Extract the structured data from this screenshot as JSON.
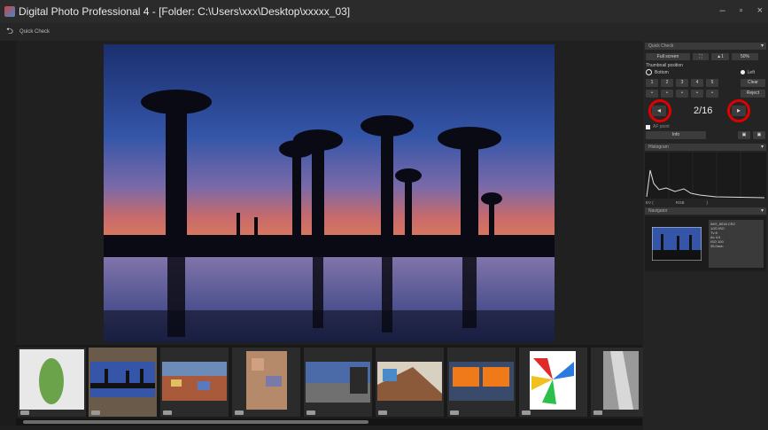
{
  "window": {
    "title": "Digital Photo Professional 4 - [Folder: C:\\Users\\xxx\\Desktop\\xxxxx_03]",
    "minimize_glyph": "–",
    "maximize_glyph": "▫",
    "close_glyph": "×"
  },
  "toolbar": {
    "back_icon": "back-arrow-icon",
    "back_glyph": "⮌",
    "title": "Quick Check"
  },
  "side_panel": {
    "header": "Quick Check",
    "full_screen": "Full screen",
    "fit_glyph": "⛶",
    "zoom_glyph": "▲1",
    "zoom_value": "50%",
    "thumbnail_position_label": "Thumbnail position",
    "bottom_label": "Bottom",
    "left_label": "Left",
    "rating_labels": [
      "1",
      "2",
      "3",
      "4",
      "5"
    ],
    "clear": "Clear",
    "dots": [
      "•",
      "•",
      "•",
      "•",
      "•"
    ],
    "reject": "Reject",
    "page_counter": "2/16",
    "prev_glyph": "◂",
    "next_glyph": "▸",
    "checkbox_label": "AF point",
    "info": "Info",
    "save_glyph": "▣",
    "histogram_header": "Histogram",
    "histogram_axis": [
      "EV (",
      "",
      "RGB",
      "",
      ")"
    ],
    "navigator_header": "Navigator",
    "info_text": [
      "IMG_8018.CR2",
      "1/20 ISO",
      "Tv 8",
      "Av 4.0",
      "ISO 100",
      "35.0mm"
    ]
  },
  "filmstrip": {
    "thumbnails": [
      "chameleon",
      "baobab",
      "village",
      "houses",
      "street",
      "graffiti",
      "orange-canopy",
      "pinwheels",
      "aerial"
    ]
  },
  "colors": {
    "accent_red": "#e10000",
    "bg": "#1f1f1f",
    "selected_thumb": "#6a5a4a"
  }
}
